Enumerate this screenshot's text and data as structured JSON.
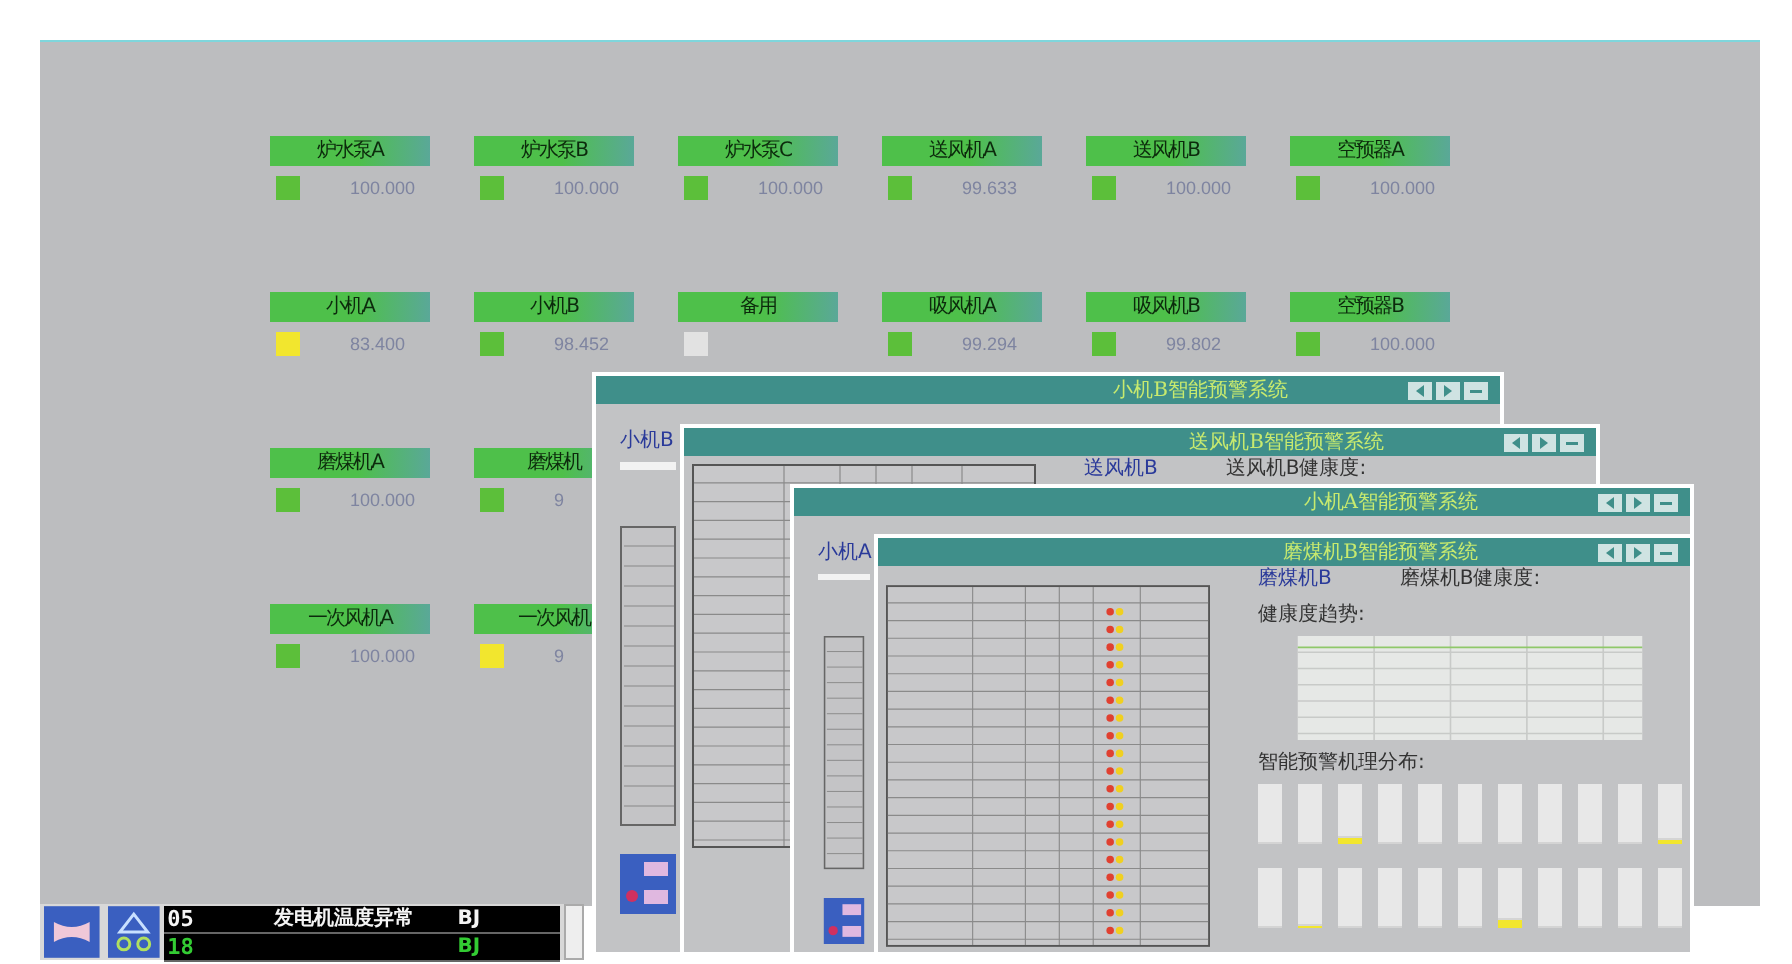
{
  "dashboard": {
    "rows": [
      [
        {
          "label": "炉水泵A",
          "value": "100.000",
          "color": "#5cbf3a"
        },
        {
          "label": "炉水泵B",
          "value": "100.000",
          "color": "#5cbf3a"
        },
        {
          "label": "炉水泵C",
          "value": "100.000",
          "color": "#5cbf3a"
        },
        {
          "label": "送风机A",
          "value": "99.633",
          "color": "#5cbf3a"
        },
        {
          "label": "送风机B",
          "value": "100.000",
          "color": "#5cbf3a"
        },
        {
          "label": "空预器A",
          "value": "100.000",
          "color": "#5cbf3a"
        }
      ],
      [
        {
          "label": "小机A",
          "value": "83.400",
          "color": "#f2e62e"
        },
        {
          "label": "小机B",
          "value": "98.452",
          "color": "#5cbf3a"
        },
        {
          "label": "备用",
          "color": "#e2e2e2"
        },
        {
          "label": "吸风机A",
          "value": "99.294",
          "color": "#5cbf3a"
        },
        {
          "label": "吸风机B",
          "value": "99.802",
          "color": "#5cbf3a"
        },
        {
          "label": "空预器B",
          "value": "100.000",
          "color": "#5cbf3a"
        }
      ],
      [
        {
          "label": "磨煤机A",
          "value": "100.000",
          "color": "#5cbf3a"
        },
        {
          "label": "磨煤机",
          "value": "9",
          "color": "#5cbf3a"
        }
      ],
      [
        {
          "label": "一次风机A",
          "value": "100.000",
          "color": "#5cbf3a"
        },
        {
          "label": "一次风机",
          "value": "9",
          "color": "#f2e62e"
        }
      ]
    ]
  },
  "windows": [
    {
      "kind": "overview",
      "title": "小机B智能预警系统",
      "label": "小机B"
    },
    {
      "kind": "detail",
      "title": "送风机B智能预警系统",
      "label": "送风机B",
      "health_label": "送风机B健康度:"
    },
    {
      "kind": "overview",
      "title": "小机A智能预警系统",
      "label": "小机A"
    },
    {
      "kind": "detail",
      "title": "磨煤机B智能预警系统",
      "label": "磨煤机B",
      "health_label": "磨煤机B健康度:",
      "trend_label": "健康度趋势:",
      "distribution_label": "智能预警机理分布:",
      "bar_rows": [
        [
          {
            "level": 0
          },
          {
            "level": 0
          },
          {
            "level": 0.1
          },
          {
            "level": 0
          },
          {
            "level": 0
          },
          {
            "level": 0
          },
          {
            "level": 0
          },
          {
            "level": 0
          },
          {
            "level": 0
          },
          {
            "level": 0
          },
          {
            "level": 0.08
          }
        ],
        [
          {
            "level": 0
          },
          {
            "level": 0.05
          },
          {
            "level": 0
          },
          {
            "level": 0
          },
          {
            "level": 0
          },
          {
            "level": 0
          },
          {
            "level": 0.15
          },
          {
            "level": 0
          },
          {
            "level": 0
          },
          {
            "level": 0
          },
          {
            "level": 0
          }
        ]
      ]
    }
  ],
  "alarms": [
    {
      "code": "05",
      "text": "发电机温度异常",
      "type": "BJ"
    },
    {
      "code": "18",
      "type": "BJ",
      "color": "#33cc33"
    }
  ]
}
